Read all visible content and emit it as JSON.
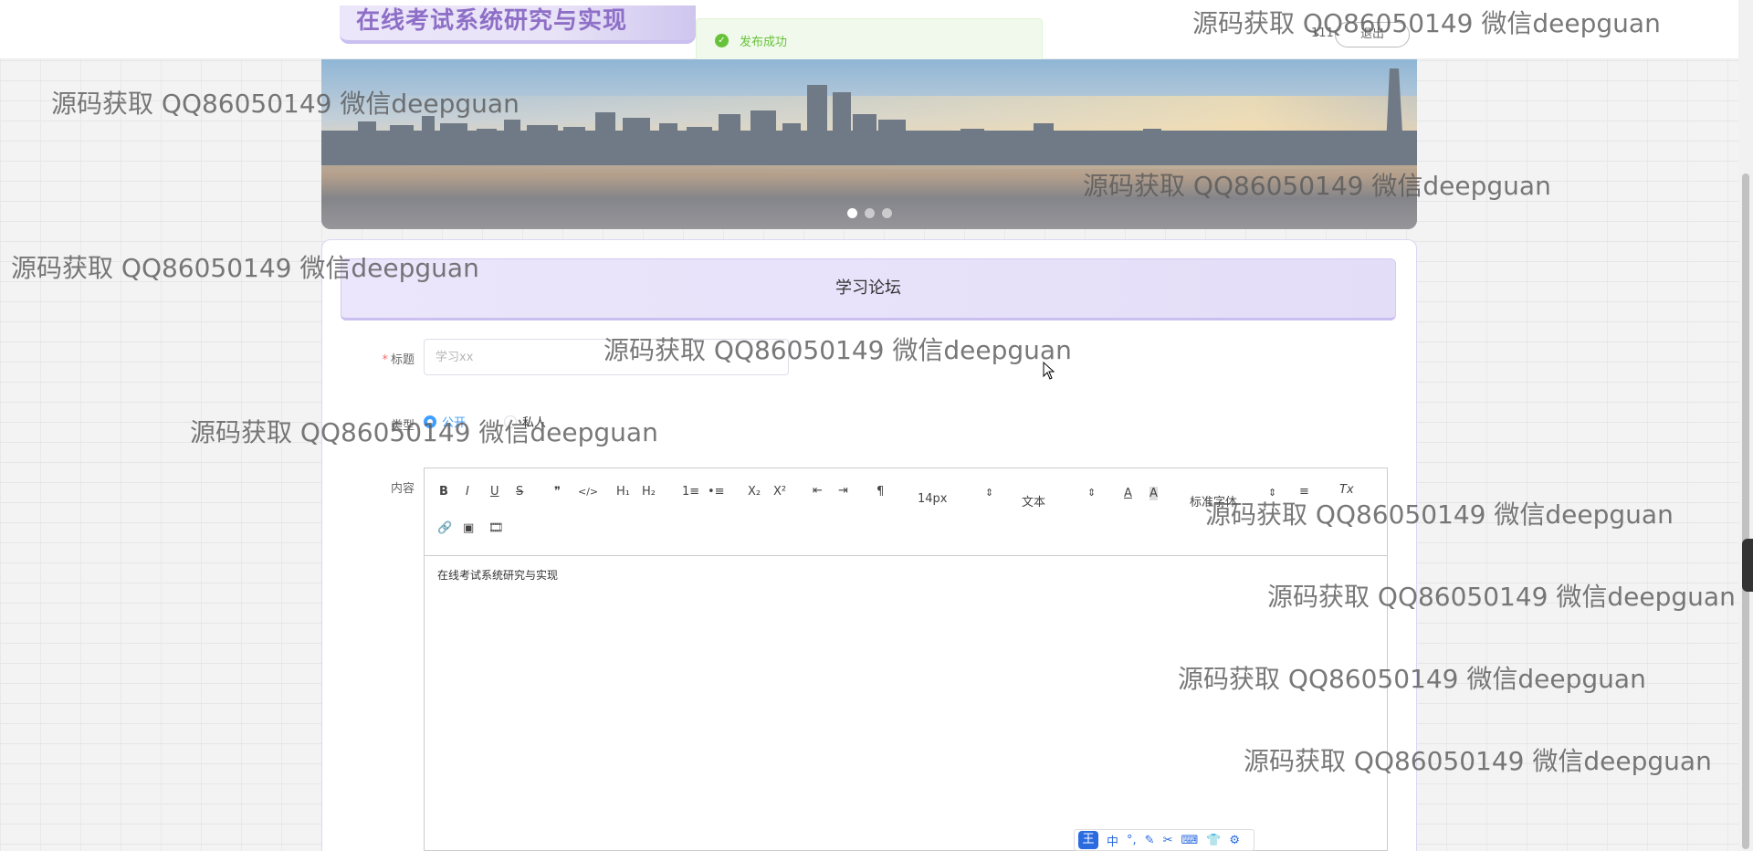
{
  "header": {
    "site_title": "在线考试系统研究与实现",
    "toast": "发布成功",
    "user_name": "111",
    "logout_label": "退出"
  },
  "banner": {
    "dots": 3,
    "active_index": 0
  },
  "forum": {
    "heading": "学习论坛",
    "title_label": "标题",
    "title_required_mark": "*",
    "title_placeholder": "学习xx",
    "type_label": "类型",
    "type_options": [
      "公开",
      "私人"
    ],
    "type_selected": "公开",
    "content_label": "内容",
    "content_text": "在线考试系统研究与实现"
  },
  "editor_toolbar": {
    "bold": "B",
    "italic": "I",
    "underline": "U",
    "strike": "S",
    "blockquote": "❞",
    "code": "</>",
    "h1": "H₁",
    "h2": "H₂",
    "ordered_list": "1≡",
    "bullet_list": "•≡",
    "subscript": "X₂",
    "superscript": "X²",
    "outdent": "⇤",
    "indent": "⇥",
    "rtl": "¶",
    "size": "14px",
    "header_select": "文本",
    "font_color": "A",
    "background_color": "A",
    "font_family": "标准字体",
    "align": "≡",
    "clean": "Tx",
    "link": "🔗",
    "image": "▣",
    "video": "🎞"
  },
  "ime_bar": {
    "logo": "王",
    "items": [
      "中",
      "°,",
      "✎",
      "✂",
      "⌨",
      "👕",
      "⚙"
    ]
  },
  "watermark_text": "源码获取 QQ86050149 微信deepguan",
  "colors": {
    "accent": "#8e6fc7",
    "primary": "#409eff",
    "success": "#67c23a"
  }
}
